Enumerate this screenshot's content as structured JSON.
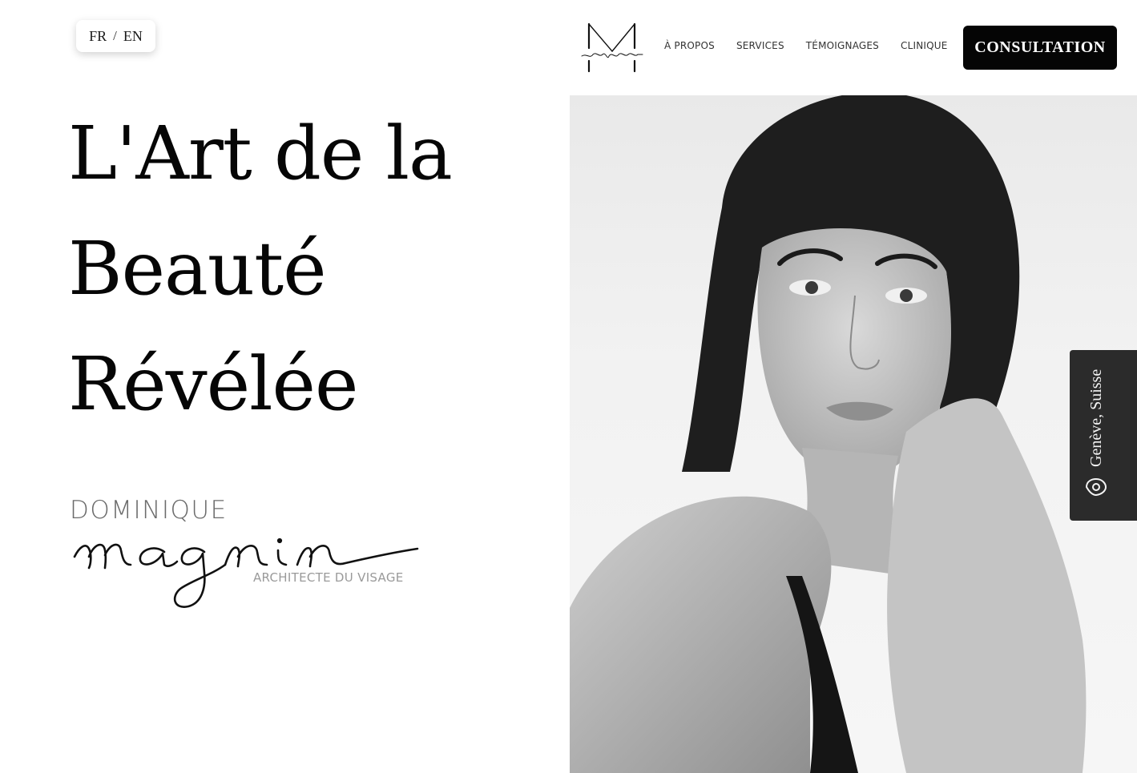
{
  "lang_switch": {
    "fr": "FR",
    "separator": "/",
    "en": "EN"
  },
  "logo": {
    "icon": "m-monogram-logo"
  },
  "nav": {
    "items": [
      {
        "label": "À PROPOS"
      },
      {
        "label": "SERVICES"
      },
      {
        "label": "TÉMOIGNAGES"
      },
      {
        "label": "CLINIQUE"
      }
    ],
    "cta_label": "CONSULTATION"
  },
  "hero": {
    "title_lines": [
      "L'Art de la",
      "Beauté",
      "Révélée"
    ]
  },
  "signature": {
    "top": "DOMINIQUE",
    "script": "magnin",
    "subtitle": "ARCHITECTE DU VISAGE"
  },
  "photo": {
    "subject": "portrait-photo"
  },
  "location": {
    "label": "Genève, Suisse",
    "icon": "location-pin-icon"
  },
  "colors": {
    "text": "#0a0a0a",
    "cta_bg": "#050505",
    "location_tab_bg": "#2b2b2b",
    "signature_gray": "#6b6b6b"
  }
}
